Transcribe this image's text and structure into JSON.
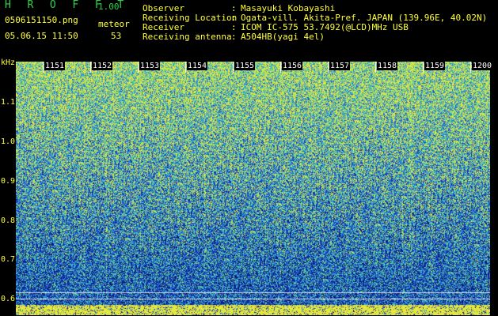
{
  "header": {
    "app_title": "H R O F F T",
    "version": "1.00",
    "filename": "0506151150.png",
    "mode": "meteor",
    "datetime": "05.06.15 11:50",
    "count": "53"
  },
  "station": {
    "labels": [
      "Observer",
      "Receiving Location",
      "Receiver",
      "Receiving antenna"
    ],
    "separator": ":",
    "values": [
      "Masayuki Kobayashi",
      "Ogata-vill. Akita-Pref. JAPAN (139.96E, 40.02N)",
      "ICOM IC-575 53.7492(@LCD)MHz USB",
      "A504HB(yagi 4el)"
    ]
  },
  "axes": {
    "freq_unit": "kHz",
    "freq_ticks": [
      "1.1",
      "1.0",
      "0.9",
      "0.8",
      "0.7",
      "0.6"
    ],
    "time_ticks": [
      "1151",
      "1152",
      "1153",
      "1154",
      "1155",
      "1156",
      "1157",
      "1158",
      "1159",
      "1200"
    ]
  }
}
